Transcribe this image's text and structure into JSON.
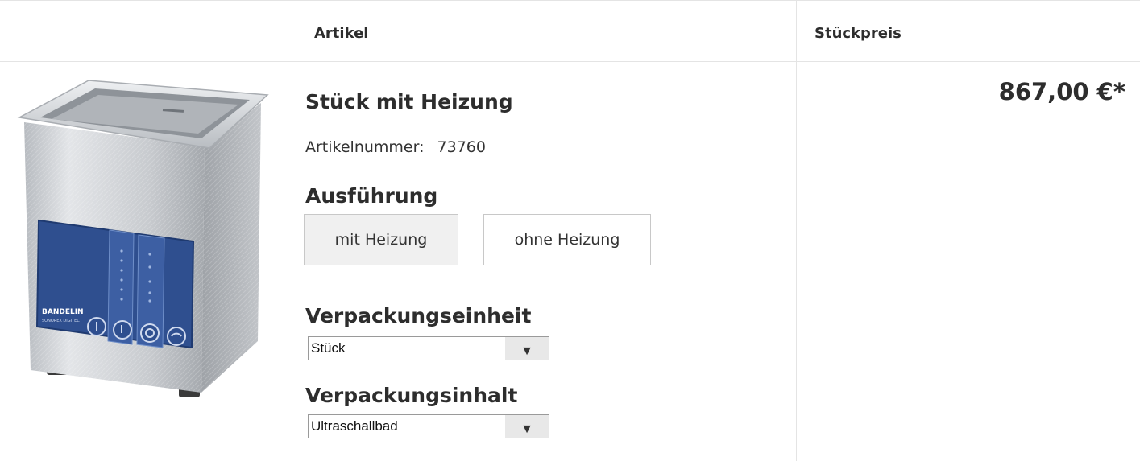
{
  "header": {
    "col_article": "Artikel",
    "col_price": "Stückpreis"
  },
  "product": {
    "title": "Stück mit Heizung",
    "article_number_label": "Artikelnummer:",
    "article_number": "73760",
    "image_brand": "BANDELIN",
    "image_model": "SONOREX DIGITEC",
    "price": "867,00 €*"
  },
  "variant": {
    "label": "Ausführung",
    "options": [
      {
        "label": "mit Heizung",
        "selected": true
      },
      {
        "label": "ohne Heizung",
        "selected": false
      }
    ]
  },
  "packaging_unit": {
    "label": "Verpackungseinheit",
    "value": "Stück"
  },
  "packaging_content": {
    "label": "Verpackungsinhalt",
    "value": "Ultraschallbad"
  },
  "colors": {
    "panel_blue": "#2f4f8f",
    "steel": "#c9ccd0",
    "border": "#e4e4e4"
  }
}
